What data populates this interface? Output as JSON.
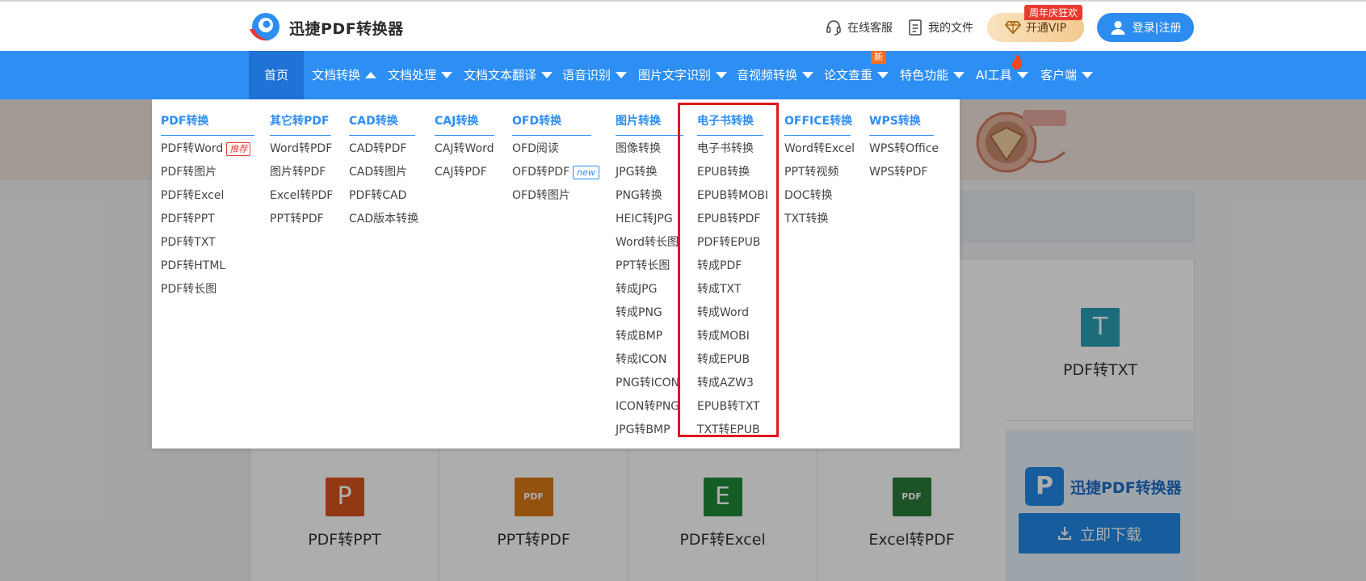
{
  "header": {
    "logo_text": "迅捷PDF转换器",
    "service_label": "在线客服",
    "files_label": "我的文件",
    "vip_label": "开通VIP",
    "vip_badge": "周年庆狂欢",
    "login_label": "登录|注册"
  },
  "nav": {
    "items": [
      {
        "label": "首页"
      },
      {
        "label": "文档转换"
      },
      {
        "label": "文档处理"
      },
      {
        "label": "文档文本翻译"
      },
      {
        "label": "语音识别"
      },
      {
        "label": "图片文字识别"
      },
      {
        "label": "音视频转换"
      },
      {
        "label": "论文查重"
      },
      {
        "label": "特色功能"
      },
      {
        "label": "AI工具"
      },
      {
        "label": "客户端"
      }
    ],
    "new_badge": "新"
  },
  "dropdown": {
    "columns": [
      {
        "title": "PDF转换",
        "items": [
          "PDF转Word",
          "PDF转图片",
          "PDF转Excel",
          "PDF转PPT",
          "PDF转TXT",
          "PDF转HTML",
          "PDF转长图"
        ],
        "tag": "推荐"
      },
      {
        "title": "其它转PDF",
        "items": [
          "Word转PDF",
          "图片转PDF",
          "Excel转PDF",
          "PPT转PDF"
        ]
      },
      {
        "title": "CAD转换",
        "items": [
          "CAD转PDF",
          "CAD转图片",
          "PDF转CAD",
          "CAD版本转换"
        ]
      },
      {
        "title": "CAJ转换",
        "items": [
          "CAJ转Word",
          "CAJ转PDF"
        ]
      },
      {
        "title": "OFD转换",
        "items": [
          "OFD阅读",
          "OFD转PDF",
          "OFD转图片"
        ],
        "tag": "new"
      },
      {
        "title": "图片转换",
        "items": [
          "图像转换",
          "JPG转换",
          "PNG转换",
          "HEIC转JPG",
          "Word转长图",
          "PPT转长图",
          "转成JPG",
          "转成PNG",
          "转成BMP",
          "转成ICON",
          "PNG转ICON",
          "ICON转PNG",
          "JPG转BMP"
        ]
      },
      {
        "title": "电子书转换",
        "items": [
          "电子书转换",
          "EPUB转换",
          "EPUB转MOBI",
          "EPUB转PDF",
          "PDF转EPUB",
          "转成PDF",
          "转成TXT",
          "转成Word",
          "转成MOBI",
          "转成EPUB",
          "转成AZW3",
          "EPUB转TXT",
          "TXT转EPUB"
        ]
      },
      {
        "title": "OFFICE转换",
        "items": [
          "Word转Excel",
          "PPT转视频",
          "DOC转换",
          "TXT转换"
        ]
      },
      {
        "title": "WPS转换",
        "items": [
          "WPS转Office",
          "WPS转PDF"
        ]
      }
    ]
  },
  "page": {
    "tiles": [
      "PDF转TXT",
      "PDF转PPT",
      "PPT转PDF",
      "PDF转Excel",
      "Excel转PDF"
    ],
    "promo_title": "迅捷PDF转换器",
    "download_label": "立即下载"
  },
  "colors": {
    "brand_blue": "#2d8ef4",
    "highlight_red": "#e3161c"
  }
}
